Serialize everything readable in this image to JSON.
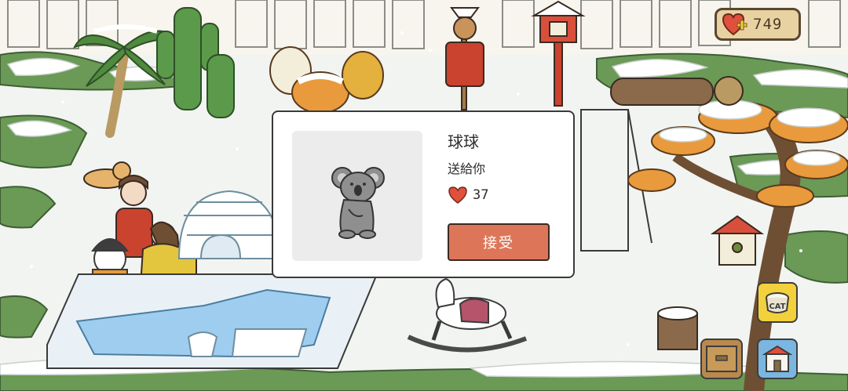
{
  "hud": {
    "hearts": "749"
  },
  "gift_popup": {
    "sender_name": "球球",
    "message": "送給你",
    "heart_value": "37",
    "accept_label": "接受",
    "item_icon": "koala-plush-icon"
  },
  "side_buttons": {
    "cat_food_label": "CAT"
  },
  "colors": {
    "accent": "#dd7659",
    "heart": "#e0503c",
    "snow": "#ffffff",
    "grass": "#5a8a4a"
  }
}
